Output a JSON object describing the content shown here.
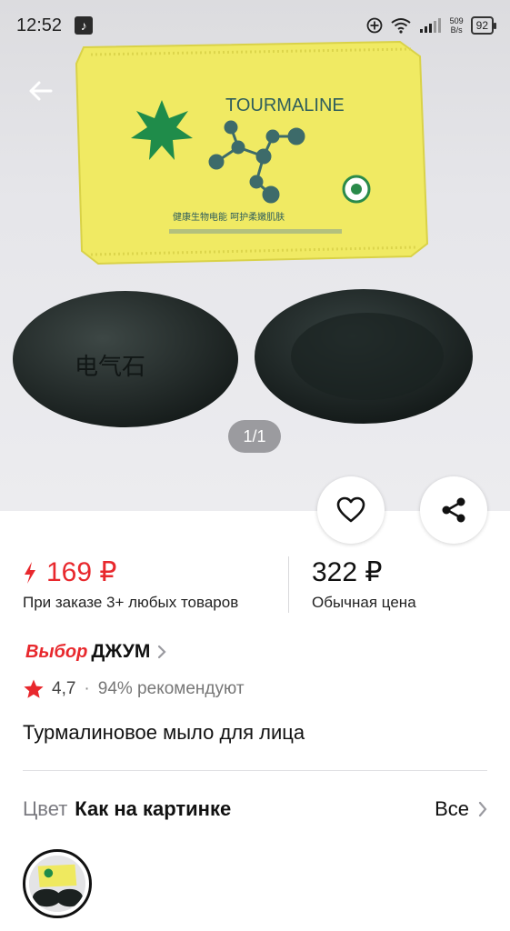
{
  "status_bar": {
    "time": "12:52",
    "net_speed_value": "509",
    "net_speed_unit": "B/s",
    "battery": "92"
  },
  "gallery": {
    "counter": "1/1",
    "package_text": "TOURMALINE",
    "package_sub1": "健康生物电能  呵护柔嫩肌肤",
    "soap_engraving": "电气石"
  },
  "price": {
    "sale": "169 ₽",
    "sale_note": "При заказе 3+ любых товаров",
    "regular": "322 ₽",
    "regular_note": "Обычная цена"
  },
  "brand": {
    "prefix": "Выбор",
    "name": "ДЖУМ"
  },
  "rating": {
    "value": "4,7",
    "separator": "·",
    "recommend": "94% рекомендуют"
  },
  "product": {
    "title": "Турмалиновое мыло для лица"
  },
  "variant": {
    "label": "Цвет",
    "value": "Как на картинке",
    "all_label": "Все"
  },
  "colors": {
    "accent": "#e8282d",
    "text": "#111111",
    "muted": "#7a7a80"
  }
}
